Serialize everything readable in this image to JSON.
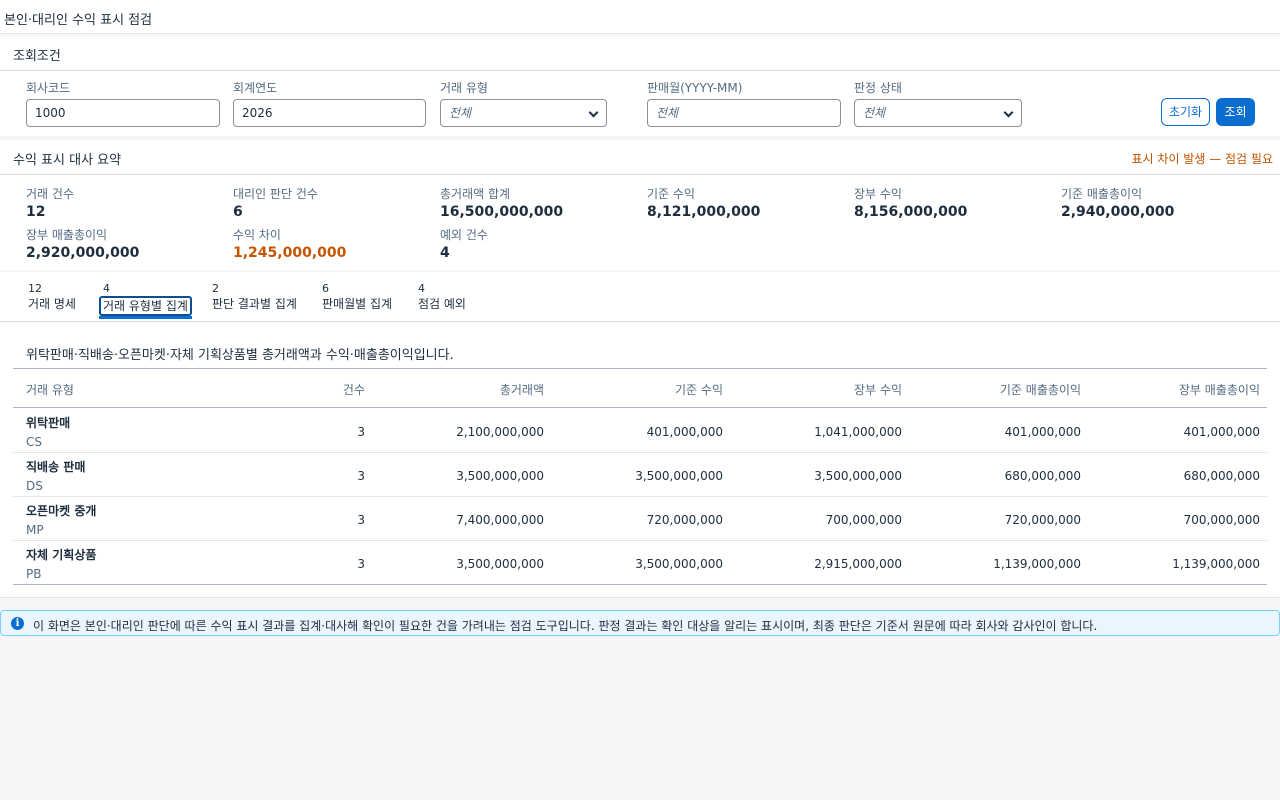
{
  "app": {
    "title": "본인·대리인 수익 표시 점검"
  },
  "filters": {
    "title": "조회조건",
    "company_code": {
      "label": "회사코드",
      "value": "1000"
    },
    "fiscal_year": {
      "label": "회계연도",
      "value": "2026"
    },
    "txn_type": {
      "label": "거래 유형",
      "value": "전체"
    },
    "sale_month": {
      "label": "판매월(YYYY-MM)",
      "placeholder": "전체"
    },
    "judgment_status": {
      "label": "판정 상태",
      "value": "전체"
    },
    "reset_label": "초기화",
    "search_label": "조회"
  },
  "summary": {
    "title": "수익 표시 대사 요약",
    "warning": "표시 차이 발생 — 점검 필요",
    "kpis": [
      {
        "label": "거래 건수",
        "value": "12"
      },
      {
        "label": "대리인 판단 건수",
        "value": "6"
      },
      {
        "label": "총거래액 합계",
        "value": "16,500,000,000"
      },
      {
        "label": "기준 수익",
        "value": "8,121,000,000"
      },
      {
        "label": "장부 수익",
        "value": "8,156,000,000"
      },
      {
        "label": "기준 매출총이익",
        "value": "2,940,000,000"
      },
      {
        "label": "장부 매출총이익",
        "value": "2,920,000,000"
      },
      {
        "label": "수익 차이",
        "value": "1,245,000,000"
      },
      {
        "label": "예외 건수",
        "value": "4"
      }
    ]
  },
  "tabs": [
    {
      "count": "12",
      "label": "거래 명세"
    },
    {
      "count": "4",
      "label": "거래 유형별 집계"
    },
    {
      "count": "2",
      "label": "판단 결과별 집계"
    },
    {
      "count": "6",
      "label": "판매월별 집계"
    },
    {
      "count": "4",
      "label": "점검 예외"
    }
  ],
  "content": {
    "description": "위탁판매·직배송·오픈마켓·자체 기획상품별 총거래액과 수익·매출총이익입니다.",
    "columns": [
      "거래 유형",
      "건수",
      "총거래액",
      "기준 수익",
      "장부 수익",
      "기준 매출총이익",
      "장부 매출총이익"
    ],
    "rows": [
      {
        "name": "위탁판매",
        "code": "CS",
        "count": "3",
        "gross": "2,100,000,000",
        "std_rev": "401,000,000",
        "book_rev": "1,041,000,000",
        "std_gp": "401,000,000",
        "book_gp": "401,000,000"
      },
      {
        "name": "직배송 판매",
        "code": "DS",
        "count": "3",
        "gross": "3,500,000,000",
        "std_rev": "3,500,000,000",
        "book_rev": "3,500,000,000",
        "std_gp": "680,000,000",
        "book_gp": "680,000,000"
      },
      {
        "name": "오픈마켓 중개",
        "code": "MP",
        "count": "3",
        "gross": "7,400,000,000",
        "std_rev": "720,000,000",
        "book_rev": "700,000,000",
        "std_gp": "720,000,000",
        "book_gp": "700,000,000"
      },
      {
        "name": "자체 기획상품",
        "code": "PB",
        "count": "3",
        "gross": "3,500,000,000",
        "std_rev": "3,500,000,000",
        "book_rev": "2,915,000,000",
        "std_gp": "1,139,000,000",
        "book_gp": "1,139,000,000"
      }
    ]
  },
  "info": {
    "icon": "info-icon",
    "text": "이 화면은 본인·대리인 판단에 따른 수익 표시 결과를 집계·대사해 확인이 필요한 건을 가려내는 점검 도구입니다. 판정 결과는 확인 대상을 알리는 표시이며, 최종 판단은 기준서 원문에 따라 회사와 감사인이 합니다."
  },
  "colors": {
    "accent": "#0a6ed1",
    "warning": "#c35500",
    "info_bg": "#eaf5fe"
  }
}
